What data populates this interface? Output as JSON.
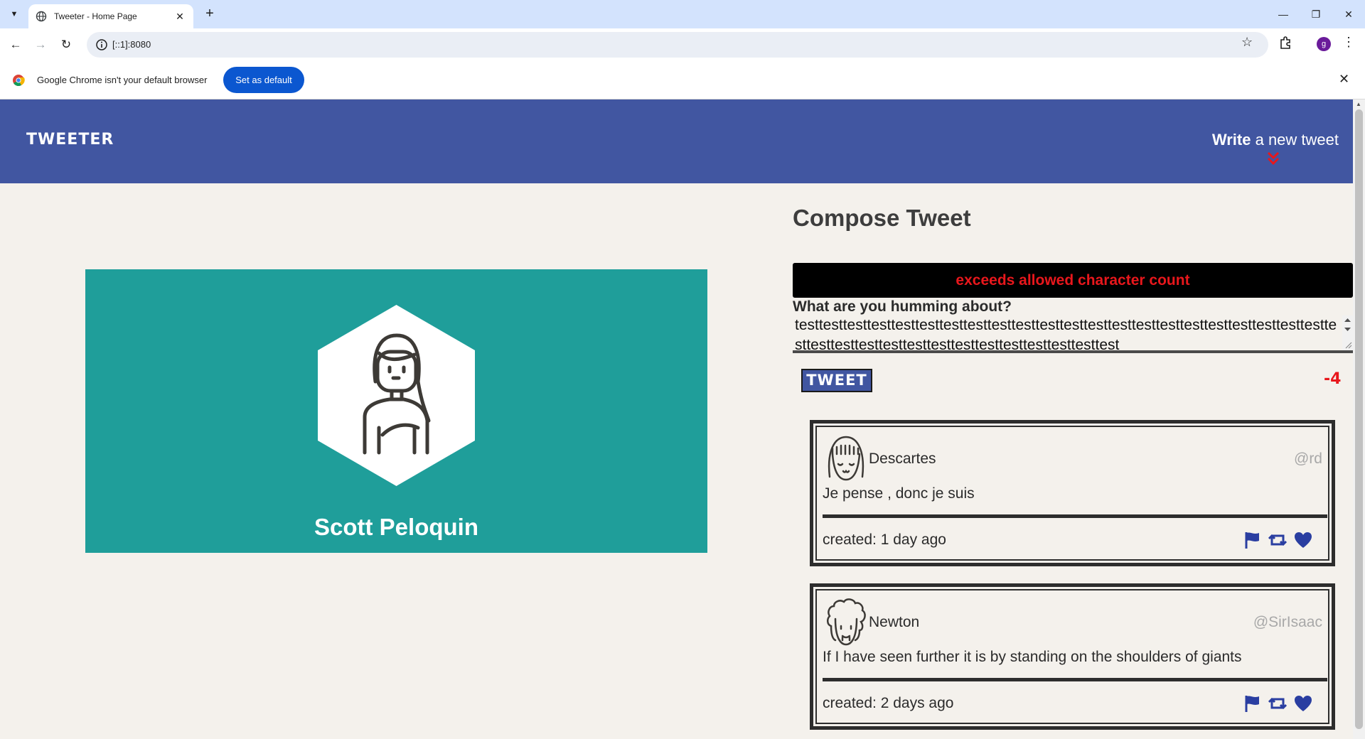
{
  "browser": {
    "tab_title": "Tweeter - Home Page",
    "url": "[::1]:8080",
    "profile_initial": "g",
    "infobar_text": "Google Chrome isn't your default browser",
    "set_default_label": "Set as default"
  },
  "navbar": {
    "brand": "TWEETER",
    "write_bold": "Write",
    "write_rest": " a new tweet"
  },
  "profile": {
    "name": "Scott Peloquin"
  },
  "compose": {
    "title": "Compose Tweet",
    "error": "exceeds allowed character count",
    "label": "What are you humming about?",
    "text": "testtesttesttesttesttesttesttesttesttesttesttesttesttesttesttesttesttesttesttesttesttesttesttesttesttesttesttesttesttesttesttesttesttesttesttest",
    "button": "TWEET",
    "counter": "-4"
  },
  "tweets": [
    {
      "name": "Descartes",
      "handle": "@rd",
      "body": "Je pense , donc je suis",
      "created": "created: 1 day ago"
    },
    {
      "name": "Newton",
      "handle": "@SirIsaac",
      "body": "If I have seen further it is by standing on the shoulders of giants",
      "created": "created: 2 days ago"
    }
  ],
  "colors": {
    "navbar": "#4156a1",
    "profile_card": "#1f9e9a",
    "error_text": "#e8171c",
    "icon_blue": "#2a3ea1",
    "page_bg": "#f4f1ec"
  },
  "icons": {
    "flag": "flag-icon",
    "retweet": "retweet-icon",
    "like": "heart-icon"
  }
}
